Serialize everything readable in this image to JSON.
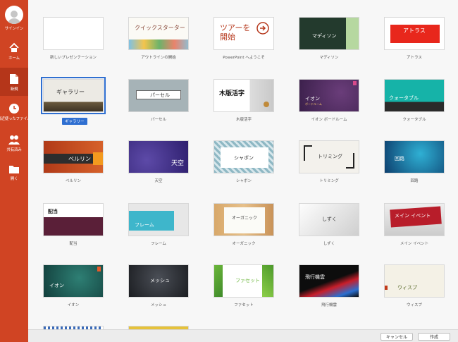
{
  "sidebar": {
    "signin": "サインイン",
    "items": [
      {
        "label": "ホーム",
        "icon": "home-icon"
      },
      {
        "label": "新規",
        "icon": "new-document-icon"
      },
      {
        "label": "最近使ったファイル",
        "icon": "clock-icon"
      },
      {
        "label": "共有済み",
        "icon": "people-icon"
      },
      {
        "label": "開く",
        "icon": "folder-icon"
      }
    ]
  },
  "templates": {
    "blank": {
      "name": "新しいプレゼンテーション"
    },
    "quickstarter": {
      "name": "アウトラインの開始",
      "title": "クイックスターター"
    },
    "tour": {
      "name": "PowerPoint へようこそ",
      "title": "ツアーを\n開始"
    },
    "madison": {
      "name": "マディソン",
      "title": "マディソン"
    },
    "atlas": {
      "name": "アトラス",
      "title": "アトラス"
    },
    "gallery": {
      "name": "ギャラリー",
      "title": "ギャラリー"
    },
    "parcel": {
      "name": "パーセル",
      "title": "パーセル"
    },
    "woodtype": {
      "name": "木版活字",
      "title": "木版活字"
    },
    "ionboard": {
      "name": "イオン ボードルーム",
      "title": "イオン",
      "subtitle": "ボードルーム"
    },
    "quotable": {
      "name": "クォータブル",
      "title": "クォータブル"
    },
    "berlin": {
      "name": "ベルリン",
      "title": "ベルリン"
    },
    "celestial": {
      "name": "天空",
      "title": "天空"
    },
    "savon": {
      "name": "シャボン",
      "title": "シャボン"
    },
    "trim": {
      "name": "トリミング",
      "title": "トリミング"
    },
    "circuit": {
      "name": "回路",
      "title": "回路"
    },
    "dividend": {
      "name": "配当",
      "title": "配当"
    },
    "frame": {
      "name": "フレーム",
      "title": "フレーム"
    },
    "organic": {
      "name": "オーガニック",
      "title": "オーガニック"
    },
    "droplet": {
      "name": "しずく",
      "title": "しずく"
    },
    "mainevent": {
      "name": "メイン イベント",
      "title": "メイン イベント"
    },
    "ion": {
      "name": "イオン",
      "title": "イオン"
    },
    "mesh": {
      "name": "メッシュ",
      "title": "メッシュ"
    },
    "facet": {
      "name": "ファセット",
      "title": "ファセット"
    },
    "vapor": {
      "name": "飛行機雲",
      "title": "飛行機雲"
    },
    "wisp": {
      "name": "ウィスプ",
      "title": "ウィスプ"
    }
  },
  "footer": {
    "cancel": "キャンセル",
    "create": "作成"
  },
  "colors": {
    "accent": "#d04423",
    "selection": "#2f6fd1"
  }
}
